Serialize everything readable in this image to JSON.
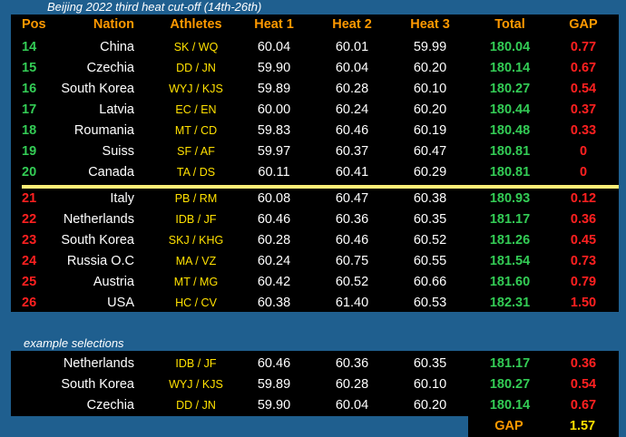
{
  "title": "Beijing 2022 third heat cut-off (14th-26th)",
  "headers": {
    "pos": "Pos",
    "nation": "Nation",
    "athletes": "Athletes",
    "heat1": "Heat 1",
    "heat2": "Heat 2",
    "heat3": "Heat 3",
    "total": "Total",
    "gap": "GAP"
  },
  "qualified_rows": [
    {
      "pos": "14",
      "nation": "China",
      "athletes": "SK / WQ",
      "h1": "60.04",
      "h2": "60.01",
      "h3": "59.99",
      "total": "180.04",
      "gap": "0.77"
    },
    {
      "pos": "15",
      "nation": "Czechia",
      "athletes": "DD / JN",
      "h1": "59.90",
      "h2": "60.04",
      "h3": "60.20",
      "total": "180.14",
      "gap": "0.67"
    },
    {
      "pos": "16",
      "nation": "South Korea",
      "athletes": "WYJ / KJS",
      "h1": "59.89",
      "h2": "60.28",
      "h3": "60.10",
      "total": "180.27",
      "gap": "0.54"
    },
    {
      "pos": "17",
      "nation": "Latvia",
      "athletes": "EC / EN",
      "h1": "60.00",
      "h2": "60.24",
      "h3": "60.20",
      "total": "180.44",
      "gap": "0.37"
    },
    {
      "pos": "18",
      "nation": "Roumania",
      "athletes": "MT / CD",
      "h1": "59.83",
      "h2": "60.46",
      "h3": "60.19",
      "total": "180.48",
      "gap": "0.33"
    },
    {
      "pos": "19",
      "nation": "Suiss",
      "athletes": "SF / AF",
      "h1": "59.97",
      "h2": "60.37",
      "h3": "60.47",
      "total": "180.81",
      "gap": "0"
    },
    {
      "pos": "20",
      "nation": "Canada",
      "athletes": "TA / DS",
      "h1": "60.11",
      "h2": "60.41",
      "h3": "60.29",
      "total": "180.81",
      "gap": "0"
    }
  ],
  "eliminated_rows": [
    {
      "pos": "21",
      "nation": "Italy",
      "athletes": "PB / RM",
      "h1": "60.08",
      "h2": "60.47",
      "h3": "60.38",
      "total": "180.93",
      "gap": "0.12"
    },
    {
      "pos": "22",
      "nation": "Netherlands",
      "athletes": "IDB / JF",
      "h1": "60.46",
      "h2": "60.36",
      "h3": "60.35",
      "total": "181.17",
      "gap": "0.36"
    },
    {
      "pos": "23",
      "nation": "South Korea",
      "athletes": "SKJ / KHG",
      "h1": "60.28",
      "h2": "60.46",
      "h3": "60.52",
      "total": "181.26",
      "gap": "0.45"
    },
    {
      "pos": "24",
      "nation": "Russia O.C",
      "athletes": "MA / VZ",
      "h1": "60.24",
      "h2": "60.75",
      "h3": "60.55",
      "total": "181.54",
      "gap": "0.73"
    },
    {
      "pos": "25",
      "nation": "Austria",
      "athletes": "MT / MG",
      "h1": "60.42",
      "h2": "60.52",
      "h3": "60.66",
      "total": "181.60",
      "gap": "0.79"
    },
    {
      "pos": "26",
      "nation": "USA",
      "athletes": "HC / CV",
      "h1": "60.38",
      "h2": "61.40",
      "h3": "60.53",
      "total": "182.31",
      "gap": "1.50"
    }
  ],
  "example_label": "example selections",
  "example_rows": [
    {
      "nation": "Netherlands",
      "athletes": "IDB / JF",
      "h1": "60.46",
      "h2": "60.36",
      "h3": "60.35",
      "total": "181.17",
      "gap": "0.36"
    },
    {
      "nation": "South Korea",
      "athletes": "WYJ / KJS",
      "h1": "59.89",
      "h2": "60.28",
      "h3": "60.10",
      "total": "180.27",
      "gap": "0.54"
    },
    {
      "nation": "Czechia",
      "athletes": "DD / JN",
      "h1": "59.90",
      "h2": "60.04",
      "h3": "60.20",
      "total": "180.14",
      "gap": "0.67"
    }
  ],
  "summary": {
    "gap_label": "GAP",
    "gap_value": "1.57"
  },
  "colors": {
    "background": "#1f5f8f",
    "panel": "#000000",
    "header": "#ff9900",
    "athletes": "#ffe000",
    "total": "#33cc55",
    "gap": "#ff2020",
    "qualified_pos": "#33cc55",
    "eliminated_pos": "#ff2020",
    "cutline": "#ffee77"
  }
}
